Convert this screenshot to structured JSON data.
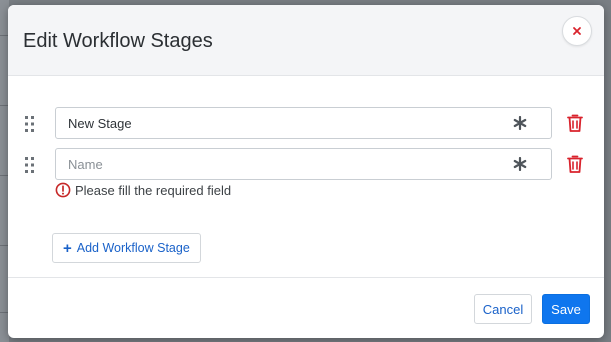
{
  "dialog": {
    "title": "Edit Workflow Stages"
  },
  "stages": [
    {
      "value": "New Stage",
      "placeholder": "Name",
      "required": true
    },
    {
      "value": "",
      "placeholder": "Name",
      "required": true,
      "error": "Please fill the required field"
    }
  ],
  "add_stage_label": "Add Workflow Stage",
  "add_stage_icon": "plus-icon",
  "footer": {
    "cancel_label": "Cancel",
    "save_label": "Save"
  },
  "icons": {
    "close": "close-icon",
    "drag": "drag-handle-icon",
    "required": "asterisk-icon",
    "delete": "trash-icon",
    "error": "error-icon"
  },
  "colors": {
    "primary": "#0f76ee",
    "link": "#1a62c9",
    "danger": "#d9232d",
    "error": "#c62828"
  }
}
